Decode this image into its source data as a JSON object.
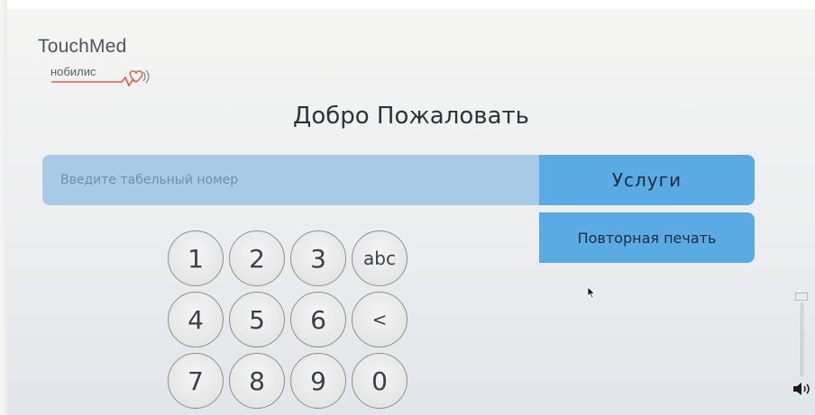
{
  "logo": {
    "main": "TouchMed",
    "sub": "нобилис"
  },
  "title": "Добро Пожаловать",
  "id_input": {
    "value": "",
    "placeholder": "Введите табельный номер"
  },
  "buttons": {
    "services": "Услуги",
    "reprint": "Повторная печать"
  },
  "keypad": {
    "keys": [
      [
        "1",
        "2",
        "3",
        "abc"
      ],
      [
        "4",
        "5",
        "6",
        "<"
      ],
      [
        "7",
        "8",
        "9",
        "0"
      ]
    ]
  },
  "colors": {
    "accent": "#5aaae3",
    "input_bg": "#a9cae6",
    "heart": "#e05a4f"
  },
  "icons": {
    "cursor": "mouse-pointer-icon",
    "volume": "volume-speaker-icon"
  }
}
